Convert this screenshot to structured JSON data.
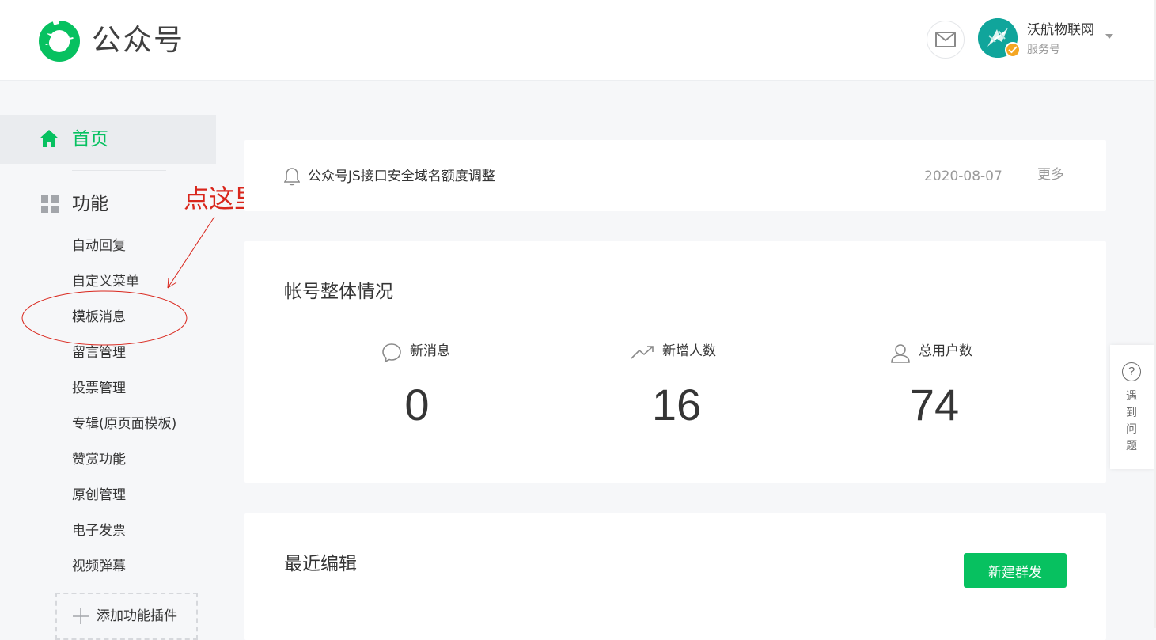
{
  "header": {
    "brand": "公众号",
    "account_name": "沃航物联网",
    "account_type": "服务号"
  },
  "sidebar": {
    "home_label": "首页",
    "section_label": "功能",
    "items": [
      {
        "label": "自动回复"
      },
      {
        "label": "自定义菜单"
      },
      {
        "label": "模板消息"
      },
      {
        "label": "留言管理"
      },
      {
        "label": "投票管理"
      },
      {
        "label": "专辑(原页面模板)"
      },
      {
        "label": "赞赏功能"
      },
      {
        "label": "原创管理"
      },
      {
        "label": "电子发票"
      },
      {
        "label": "视频弹幕"
      }
    ],
    "add_plugin_label": "添加功能插件"
  },
  "annotation": {
    "text": "点这里",
    "color": "#d9261c"
  },
  "notice": {
    "text": "公众号JS接口安全域名额度调整",
    "date": "2020-08-07",
    "more": "更多"
  },
  "overview": {
    "title": "帐号整体情况",
    "stats": [
      {
        "label": "新消息",
        "value": "0",
        "icon": "chat-bubble-icon"
      },
      {
        "label": "新增人数",
        "value": "16",
        "icon": "trend-up-icon"
      },
      {
        "label": "总用户数",
        "value": "74",
        "icon": "user-icon"
      }
    ]
  },
  "recent": {
    "title": "最近编辑",
    "new_button": "新建群发"
  },
  "help": {
    "text": "遇到问题"
  },
  "colors": {
    "accent": "#07c160",
    "background": "#f6f7f9",
    "annotation": "#d9261c"
  }
}
